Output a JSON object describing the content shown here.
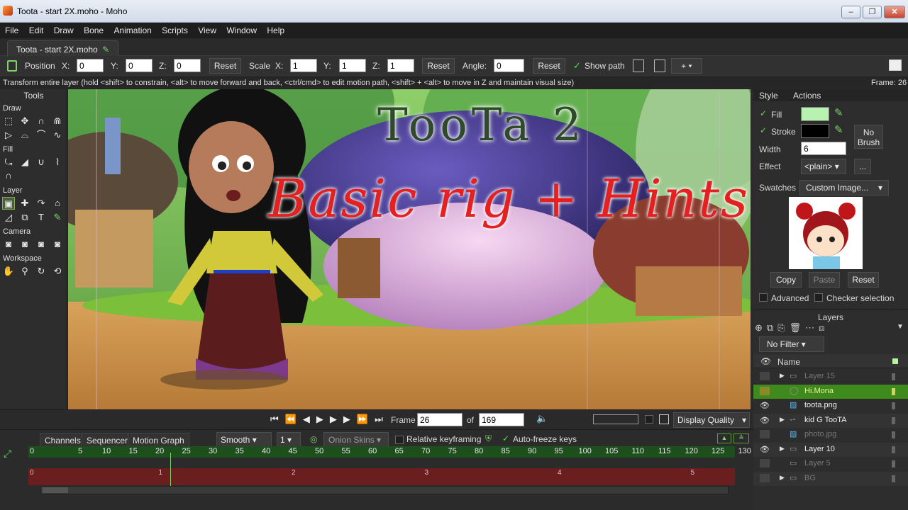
{
  "window": {
    "title": "Toota - start 2X.moho - Moho",
    "minimize": "–",
    "maximize": "❐",
    "close": "✕"
  },
  "menu": [
    "File",
    "Edit",
    "Draw",
    "Bone",
    "Animation",
    "Scripts",
    "View",
    "Window",
    "Help"
  ],
  "doc_tab": "Toota - start 2X.moho",
  "options": {
    "position_label": "Position",
    "x_label": "X:",
    "y_label": "Y:",
    "z_label": "Z:",
    "pos_x": "0",
    "pos_y": "0",
    "pos_z": "0",
    "reset1": "Reset",
    "scale_label": "Scale",
    "sx_label": "X:",
    "sy_label": "Y:",
    "sz_label": "Z:",
    "scale_x": "1",
    "scale_y": "1",
    "scale_z": "1",
    "reset2": "Reset",
    "angle_label": "Angle:",
    "angle": "0",
    "reset3": "Reset",
    "show_path": "Show path"
  },
  "status": {
    "hint": "Transform entire layer (hold <shift> to constrain, <alt> to move forward and back, <ctrl/cmd> to edit motion path, <shift> + <alt> to move in Z and maintain visual size)",
    "frame": "Frame: 26"
  },
  "tools": {
    "title": "Tools",
    "sections": {
      "draw": "Draw",
      "fill": "Fill",
      "layer": "Layer",
      "camera": "Camera",
      "workspace": "Workspace"
    }
  },
  "canvas": {
    "title1": "TooTa 2",
    "title2": "Basic rig + Hints"
  },
  "style_panel": {
    "tab_style": "Style",
    "tab_actions": "Actions",
    "fill": "Fill",
    "stroke": "Stroke",
    "fill_color": "#b8f2b0",
    "stroke_color": "#000000",
    "width_label": "Width",
    "width_value": "6",
    "no_brush": "No Brush",
    "effect_label": "Effect",
    "effect_value": "<plain>",
    "effect_more": "...",
    "swatches_label": "Swatches",
    "swatches_value": "Custom Image...",
    "copy": "Copy",
    "paste": "Paste",
    "reset": "Reset",
    "advanced": "Advanced",
    "checker": "Checker selection"
  },
  "layers_panel": {
    "title": "Layers",
    "filter": "No Filter",
    "name_col": "Name",
    "rows": [
      {
        "name": "Layer 15",
        "dim": true,
        "expand": "▶",
        "type": "folder-icon"
      },
      {
        "name": "Hi.Mona",
        "dim": false,
        "selected": true,
        "expand": "",
        "type": "vector-icon"
      },
      {
        "name": "toota.png",
        "dim": false,
        "expand": "",
        "type": "image-icon"
      },
      {
        "name": "kid G TooTA",
        "dim": false,
        "expand": "▶",
        "type": "bone-icon"
      },
      {
        "name": "photo.jpg",
        "dim": true,
        "expand": "",
        "type": "image-icon"
      },
      {
        "name": "Layer 10",
        "dim": false,
        "expand": "▶",
        "type": "folder-icon"
      },
      {
        "name": "Layer 5",
        "dim": true,
        "expand": "",
        "type": "folder-icon"
      },
      {
        "name": "BG",
        "dim": true,
        "expand": "▶",
        "type": "folder-icon"
      }
    ]
  },
  "transport": {
    "frame_label": "Frame",
    "frame": "26",
    "of_label": "of",
    "total": "169",
    "display_quality": "Display Quality"
  },
  "timeline": {
    "tabs": [
      "Channels",
      "Sequencer",
      "Motion Graph"
    ],
    "interp": "Smooth",
    "step": "1",
    "onion": "Onion Skins",
    "relative": "Relative keyframing",
    "autofreeze": "Auto-freeze keys",
    "ruler": [
      "0",
      "5",
      "10",
      "15",
      "20",
      "25",
      "30",
      "35",
      "40",
      "45",
      "50",
      "55",
      "60",
      "65",
      "70",
      "75",
      "80",
      "85",
      "90",
      "95",
      "100",
      "105",
      "110",
      "115",
      "120",
      "125",
      "130"
    ],
    "sub_ruler": [
      "0",
      "1",
      "2",
      "3",
      "4",
      "5"
    ]
  }
}
